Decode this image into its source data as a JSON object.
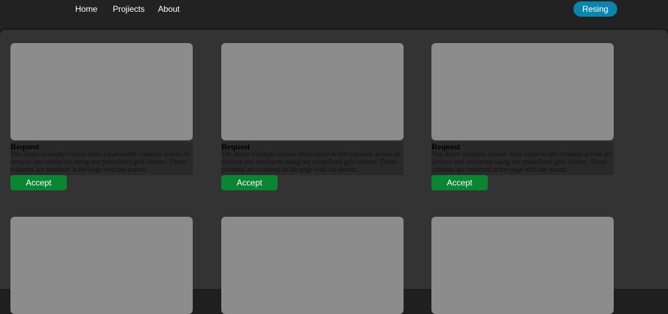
{
  "nav": {
    "home": "Home",
    "projects": "Projiects",
    "about": "About",
    "cta": "Resing"
  },
  "cards": [
    {
      "title": "Request",
      "text": "The above example creates three equal-width columns across all devices and viewports using our predefined grid classes. Those columns are centered in the page with the parent.",
      "button": "Accept"
    },
    {
      "title": "Request",
      "text": "The above example creates three equal-width columns across all devices and viewports using our predefined grid classes. Those columns are centered in the page with the parent.",
      "button": "Accept"
    },
    {
      "title": "Request",
      "text": "The above example creates three equal-width columns across all devices and viewports using our predefined grid classes. Those columns are centered in the page with the parent.",
      "button": "Accept"
    },
    {
      "title": "",
      "text": "",
      "button": ""
    },
    {
      "title": "",
      "text": "",
      "button": ""
    },
    {
      "title": "",
      "text": "",
      "button": ""
    }
  ]
}
